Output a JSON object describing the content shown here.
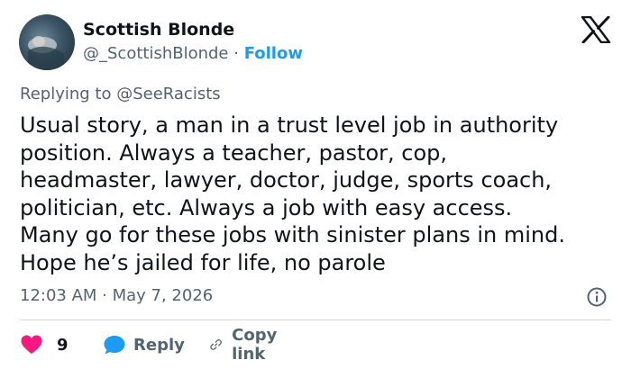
{
  "author": {
    "display_name": "Scottish Blonde",
    "handle": "@_ScottishBlonde",
    "separator": " · ",
    "follow_label": "Follow"
  },
  "reply_context": {
    "prefix": "Replying to ",
    "mention": "@SeeRacists"
  },
  "tweet": {
    "lines": [
      "Usual story, a man in a trust level job in authority",
      "position. Always a teacher, pastor, cop,",
      "headmaster, lawyer, doctor, judge, sports coach,",
      "politician, etc. Always a job with easy access.",
      "Many go for these jobs with sinister plans in mind.",
      "Hope he’s jailed for life, no parole"
    ],
    "timestamp": "12:03 AM · May 7, 2026"
  },
  "actions": {
    "like_count": "9",
    "reply_label": "Reply",
    "copy_label": "Copy link"
  },
  "colors": {
    "accent": "#1d9bf0",
    "like": "#f91880",
    "muted": "#536471",
    "text": "#0f1419"
  },
  "icons": [
    "x-logo-icon",
    "info-icon",
    "heart-icon",
    "reply-bubble-icon",
    "link-icon"
  ]
}
